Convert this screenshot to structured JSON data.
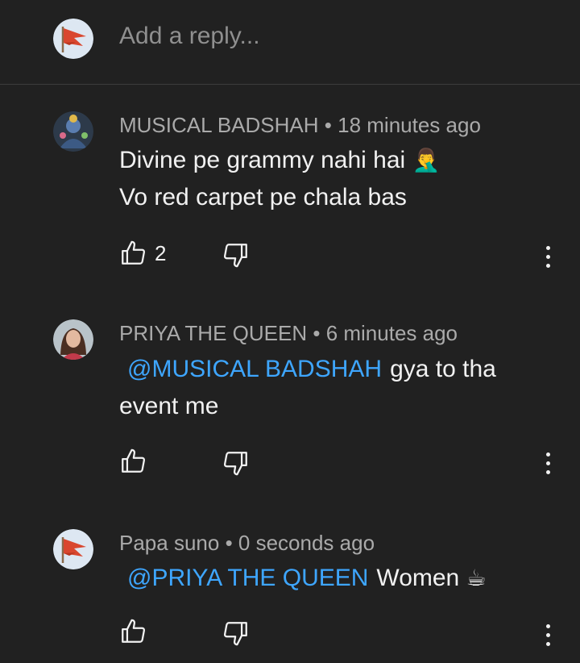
{
  "reply_bar": {
    "placeholder": "Add a reply..."
  },
  "comments": [
    {
      "author": "MUSICAL BADSHAH",
      "separator": "•",
      "time": "18 minutes ago",
      "line1": "Divine pe grammy nahi hai",
      "line1_emoji": "🤦‍♂️",
      "line2": "Vo red carpet pe chala bas",
      "likes": "2"
    },
    {
      "author": "PRIYA THE QUEEN",
      "separator": "•",
      "time": "6 minutes ago",
      "mention": "@MUSICAL BADSHAH",
      "text_after_mention": "gya to tha",
      "line2": "event me",
      "likes": ""
    },
    {
      "author": "Papa suno",
      "separator": "•",
      "time": "0 seconds ago",
      "mention": "@PRIYA THE QUEEN",
      "text_after_mention": "Women",
      "emoji": "☕",
      "likes": ""
    }
  ],
  "colors": {
    "background": "#212121",
    "text": "#f1f1f1",
    "meta": "#aaaaaa",
    "mention": "#3ea6ff",
    "flag_red": "#d9472f"
  },
  "icons": [
    "flag-avatar-icon",
    "like-icon",
    "dislike-icon",
    "more-vert-icon"
  ]
}
